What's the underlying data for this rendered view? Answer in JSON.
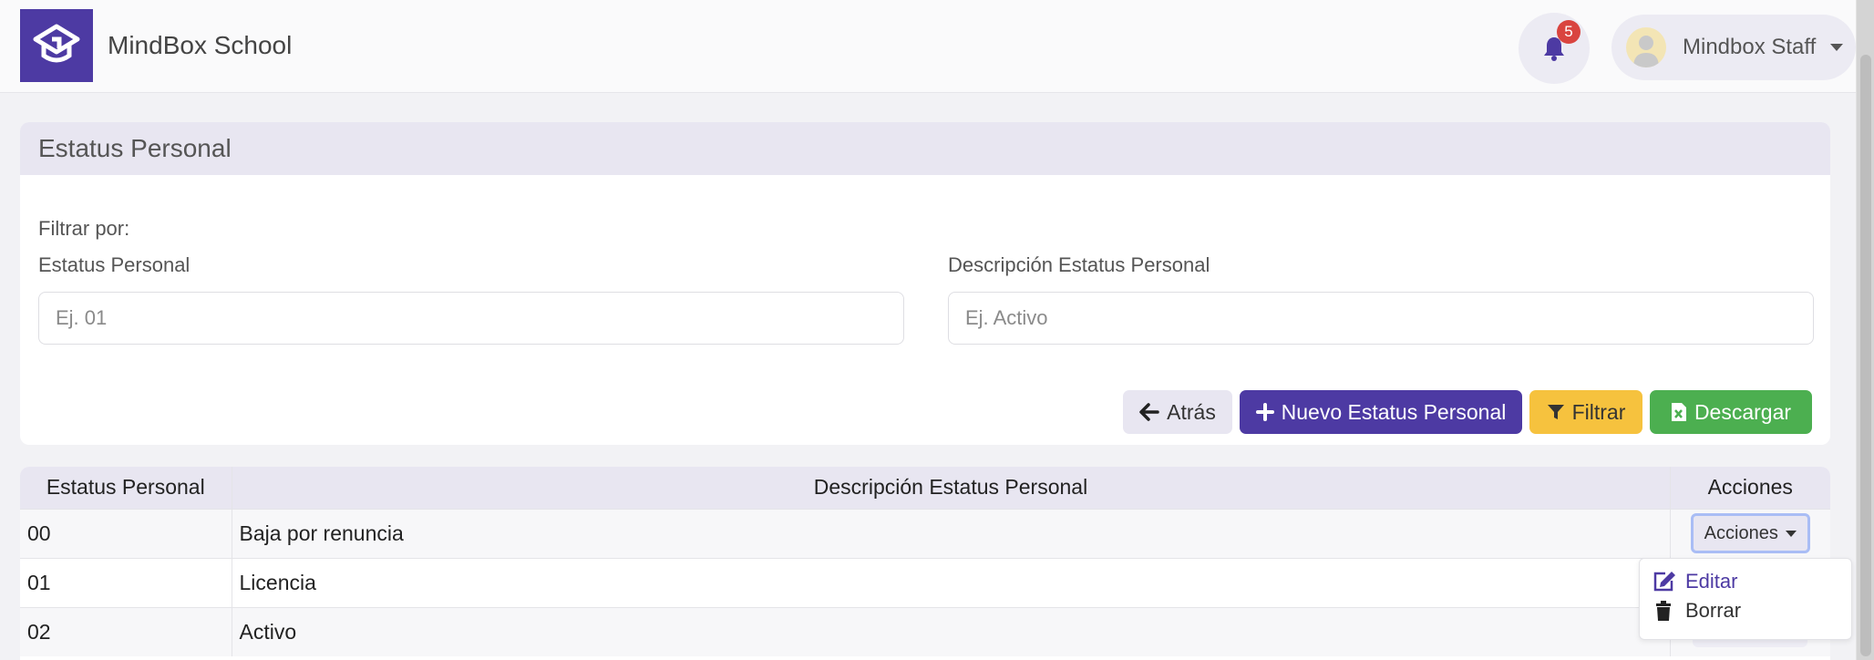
{
  "app": {
    "title": "MindBox School"
  },
  "header": {
    "notifications_count": "5",
    "user_name": "Mindbox Staff"
  },
  "card": {
    "title": "Estatus Personal",
    "filter_label": "Filtrar por:",
    "fields": [
      {
        "label": "Estatus Personal",
        "placeholder": "Ej. 01",
        "value": ""
      },
      {
        "label": "Descripción Estatus Personal",
        "placeholder": "Ej. Activo",
        "value": ""
      }
    ],
    "buttons": {
      "back": "Atrás",
      "new": "Nuevo Estatus Personal",
      "filter": "Filtrar",
      "download": "Descargar"
    }
  },
  "table": {
    "headers": [
      "Estatus Personal",
      "Descripción Estatus Personal",
      "Acciones"
    ],
    "rows": [
      {
        "code": "00",
        "description": "Baja por renuncia"
      },
      {
        "code": "01",
        "description": "Licencia"
      },
      {
        "code": "02",
        "description": "Activo"
      }
    ],
    "actions_label": "Acciones"
  },
  "dropdown": {
    "edit": "Editar",
    "delete": "Borrar"
  },
  "colors": {
    "brand": "#4d3aa3",
    "warning": "#f6c23e",
    "success": "#4caf50",
    "badge": "#d9443f"
  },
  "icons": [
    "logo-icon",
    "bell-icon",
    "user-avatar-icon",
    "arrow-left-icon",
    "plus-icon",
    "filter-icon",
    "excel-file-icon",
    "edit-icon",
    "trash-icon"
  ]
}
